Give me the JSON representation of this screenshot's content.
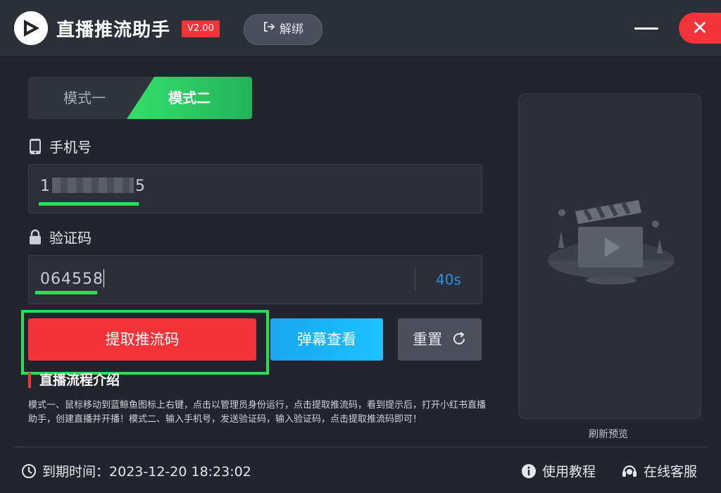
{
  "titlebar": {
    "app_title": "直播推流助手",
    "version": "V2.00",
    "unbind_label": "解绑",
    "close_glyph": "✕"
  },
  "mode_tabs": [
    {
      "label": "模式一",
      "active": false
    },
    {
      "label": "模式二",
      "active": true
    }
  ],
  "phone": {
    "label": "手机号",
    "value_prefix": "1",
    "value_suffix": "5"
  },
  "code": {
    "label": "验证码",
    "value": "064558",
    "countdown": "40s"
  },
  "buttons": {
    "extract": "提取推流码",
    "danmu": "弹幕查看",
    "reset": "重置"
  },
  "intro": {
    "title": "直播流程介绍",
    "text": "模式一、鼠标移动到蓝鲸鱼图标上右键，点击以管理员身份运行，点击提取推流码，看到提示后，打开小红书直播助手，创建直播并开播！模式二、输入手机号，发送验证码，输入验证码，点击提取推流码即可！"
  },
  "preview": {
    "label": "刷新预览"
  },
  "footer": {
    "expire_label": "到期时间：",
    "expire_value": "2023-12-20 18:23:02",
    "tutorial": "使用教程",
    "service": "在线客服"
  },
  "colors": {
    "accent_red": "#f2333a",
    "accent_green": "#22e355",
    "accent_blue": "#1aa6f0",
    "background": "#22252d"
  },
  "icons": [
    "play-logo-icon",
    "unbind-icon",
    "minimize-icon",
    "close-icon",
    "phone-icon",
    "lock-icon",
    "refresh-icon",
    "clapperboard-icon",
    "clock-icon",
    "info-icon",
    "headset-icon"
  ]
}
